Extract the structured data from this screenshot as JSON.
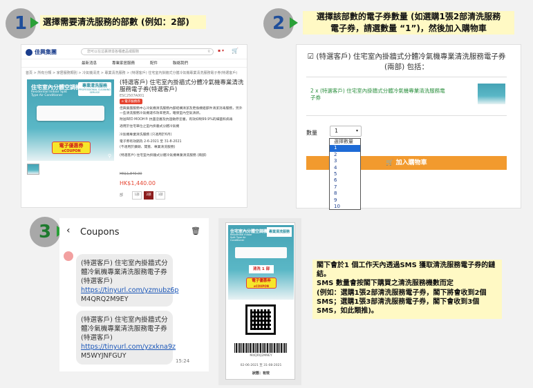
{
  "steps": [
    {
      "number": "1",
      "text": "選擇需要清洗服務的部數 (例如：2部)"
    },
    {
      "number": "2",
      "line1": "選擇該部數的電子券數量 (如選購1張2部清洗服務",
      "line2": "電子券，請選數量 “1”)，然後加入購物車"
    },
    {
      "number": "3"
    }
  ],
  "shop": {
    "logo": "佳興集團",
    "search_placeholder": "您可以在這裏搜尋各種產品或服務",
    "nav": [
      "最新消息",
      "專業家居服務",
      "配件",
      "聯絡我們"
    ],
    "breadcrumb": "首頁 > 所有分類 > 家居服務類別 > 冷氣機清洗 > 專業清洗服務 > (特選客戶) 住宅室內掛牆式分體冷氣機專業清洗服務電子券(特選客戶)",
    "product_title": "(特選客戶) 住宅室內掛牆式分體冷氣機專業清洗服務電子券(特選客戶)",
    "sku": "ESC2507A001",
    "tag": "e 電子服務券",
    "desc1": "佳興集團服務中心冷氣機清洗服務內部結構清潔及更換機組部件清潔消毒服務，另外一些清洗服務冷氣機運作效率更高，確保室內空氣清新。",
    "desc2": "附送RED MOOH® 抗菌塗層及抗過敏原塗層，有效抑制99.9%的細菌和病毒",
    "desc3": "適用於住宅單位之室內掛牆式分體冷氣機",
    "validity1": "冷氣機專業清洗服務 (只適用於6月)",
    "validity2": "電子券有效期為 2-6-2021 至 31-8-2021",
    "validity3": "(不適用於鑽頭、開蓋、專業清洗服務)",
    "variant_label": "(特選客戶) 住宅室內掛牆式分體冷氣機專業清洗服務 (兩部)",
    "price_old": "HK$1,840.00",
    "price": "HK$1,440.00",
    "img_title": "住宅室內分體空調機",
    "img_sub": "Residential Indoor Split Type Air Conditioner",
    "img_badge_title": "專業清洗服務",
    "img_badge_sub": "PROFESSIONAL CLEANING SERVICE",
    "coupon_title": "電子優惠券",
    "coupon_sub": "eCOUPON",
    "qty_options": [
      "1部",
      "2部",
      "3部"
    ]
  },
  "cart": {
    "title": "(特選客戶) 住宅室內掛牆式分體冷氣機專業清洗服務電子券 (兩部) 包括：",
    "item": "2 x (特選客戶) 住宅室內掛牆式分體冷氣機專業清洗服務電子券",
    "qty_label": "數量",
    "qty_value": "1",
    "dropdown": [
      "選擇數量",
      "1",
      "2",
      "3",
      "4",
      "5",
      "6",
      "7",
      "8",
      "9",
      "10"
    ],
    "add_to_cart": "加入購物車"
  },
  "sms": {
    "header": "Coupons",
    "msg1_text": "(特選客戶) 住宅室內掛牆式分體冷氣機專業清洗服務電子券(特選客戶)",
    "msg1_link": "https://tinyurl.com/yzmubz6p",
    "msg1_code": "M4QRQ2M9EY",
    "msg2_text": "(特選客戶) 住宅室內掛牆式分體冷氣機專業清洗服務電子券(特選客戶)",
    "msg2_link": "https://tinyurl.com/yzxkna9z",
    "msg2_code": "M5WYJNFGUY",
    "time": "15:24"
  },
  "ecoupon": {
    "img_title": "住宅室內分體空調機",
    "img_sub": "Residential Indoor Split Type Air Conditioner",
    "badge_title": "專業清洗服務",
    "count": "清洗 1 部",
    "coupon_title": "電子優惠券",
    "coupon_sub": "eCOUPON",
    "code": "M4QRQ2M9EY",
    "validity": "02-06-2021 至 31-08-2021",
    "status": "狀態：有效"
  },
  "note": {
    "line1": "閣下會於1 個工作天內透過SMS 獲取清洗服務電子券的鏈結。",
    "line2": "SMS 數量會按閣下購買之清洗服務機數而定",
    "line3": "(例如：選購1張2部清洗服務電子券，閣下將會收到2個 SMS；選購1張3部清洗服務電子券，閣下會收到3個SMS，如此類推)。"
  },
  "colors": {
    "accent": "#2aa038",
    "orange": "#f29a2e",
    "note_bg": "#fff9c4",
    "step_circle": "#a8a8a8"
  }
}
